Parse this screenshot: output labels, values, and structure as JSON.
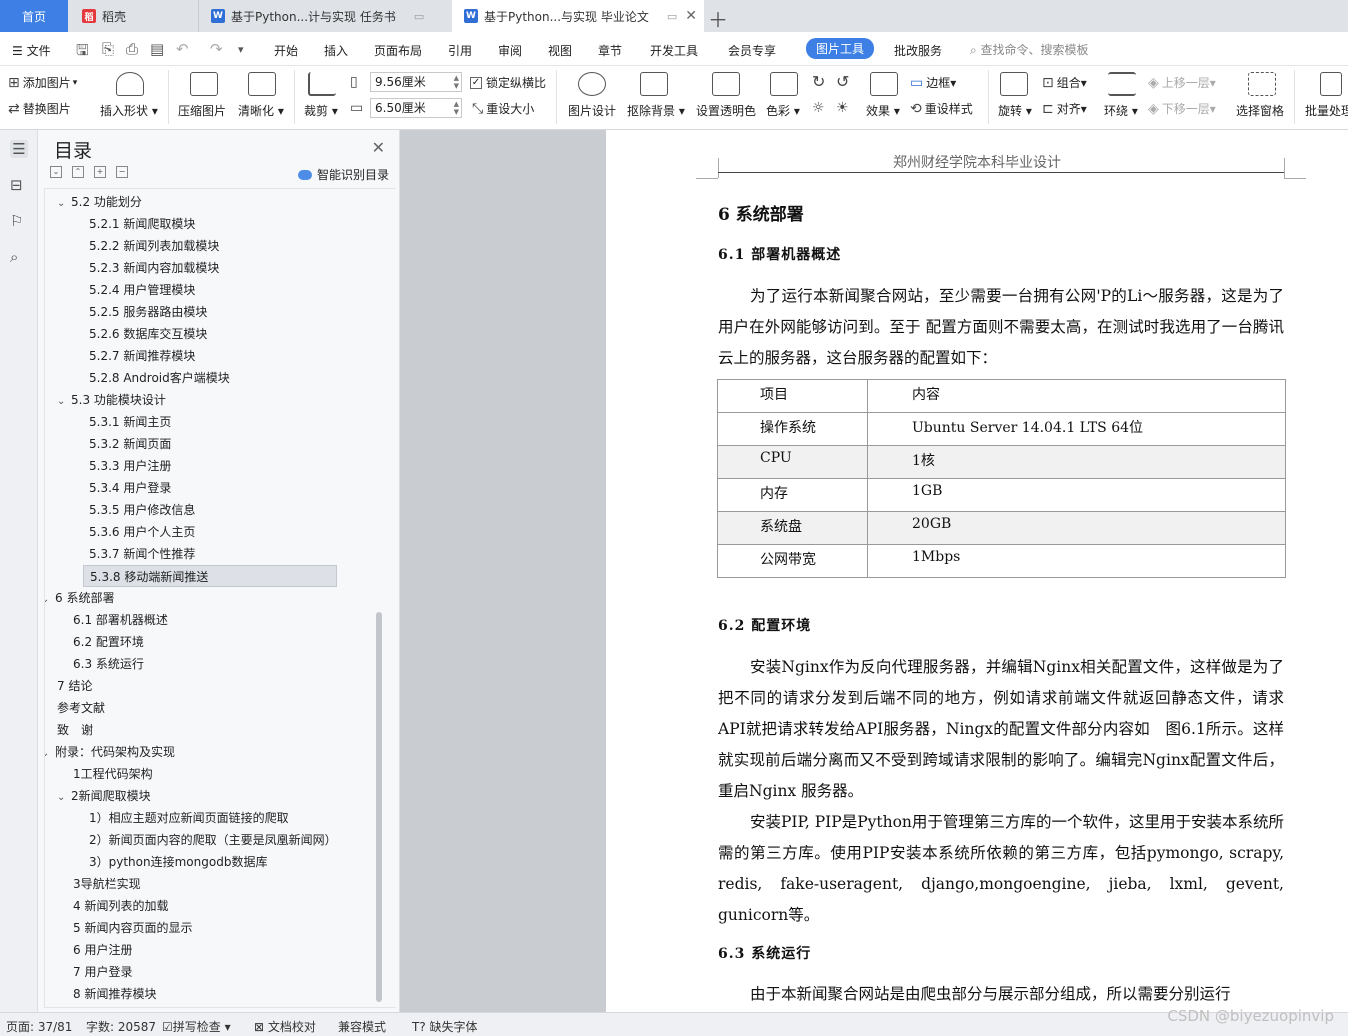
{
  "tabs": {
    "home": "首页",
    "t1": "稻壳",
    "t2": "基于Python...计与实现 任务书",
    "t3": "基于Python...与实现 毕业论文"
  },
  "menu": {
    "file": "文件",
    "items": [
      "开始",
      "插入",
      "页面布局",
      "引用",
      "审阅",
      "视图",
      "章节",
      "开发工具",
      "会员专享",
      "图片工具",
      "批改服务"
    ],
    "search": "查找命令、搜索模板"
  },
  "ribbon": {
    "add_image": "添加图片",
    "replace_image": "替换图片",
    "insert_shape": "插入形状",
    "compress": "压缩图片",
    "sharpen": "清晰化",
    "crop": "裁剪",
    "width": "9.56厘米",
    "height": "6.50厘米",
    "lock_ratio": "锁定纵横比",
    "reset_size": "重设大小",
    "image_design": "图片设计",
    "remove_bg": "抠除背景",
    "set_transparent": "设置透明色",
    "color": "色彩",
    "effect": "效果",
    "border": "边框",
    "reset_style": "重设样式",
    "rotate": "旋转",
    "group": "组合",
    "align": "对齐",
    "wrap": "环绕",
    "bring_forward": "上移一层",
    "send_backward": "下移一层",
    "selection_pane": "选择窗格",
    "batch": "批量处理"
  },
  "toc": {
    "title": "目录",
    "smart": "智能识别目录",
    "items": [
      {
        "text": "5.2 功能划分",
        "indent": 1,
        "caret": "down"
      },
      {
        "text": "5.2.1 新闻爬取模块",
        "indent": 2
      },
      {
        "text": "5.2.2 新闻列表加载模块",
        "indent": 2
      },
      {
        "text": "5.2.3 新闻内容加载模块",
        "indent": 2
      },
      {
        "text": "5.2.4 用户管理模块",
        "indent": 2
      },
      {
        "text": "5.2.5 服务器路由模块",
        "indent": 2
      },
      {
        "text": "5.2.6 数据库交互模块",
        "indent": 2
      },
      {
        "text": "5.2.7 新闻推荐模块",
        "indent": 2
      },
      {
        "text": "5.2.8 Android客户端模块",
        "indent": 2
      },
      {
        "text": "5.3 功能模块设计",
        "indent": 1,
        "caret": "down"
      },
      {
        "text": "5.3.1 新闻主页",
        "indent": 2
      },
      {
        "text": "5.3.2 新闻页面",
        "indent": 2
      },
      {
        "text": "5.3.3 用户注册",
        "indent": 2
      },
      {
        "text": "5.3.4 用户登录",
        "indent": 2
      },
      {
        "text": "5.3.5 用户修改信息",
        "indent": 2
      },
      {
        "text": "5.3.6 用户个人主页",
        "indent": 2
      },
      {
        "text": "5.3.7 新闻个性推荐",
        "indent": 2
      },
      {
        "text": "5.3.8 移动端新闻推送",
        "indent": 2,
        "selected": true
      },
      {
        "text": "6 系统部署",
        "indent": 0,
        "caret": "down"
      },
      {
        "text": "6.1 部署机器概述",
        "indent": 1
      },
      {
        "text": "6.2 配置环境",
        "indent": 1
      },
      {
        "text": "6.3 系统运行",
        "indent": 1
      },
      {
        "text": "7 结论",
        "indent": 0
      },
      {
        "text": "参考文献",
        "indent": 0
      },
      {
        "text": "致　谢",
        "indent": 0
      },
      {
        "text": "附录：代码架构及实现",
        "indent": 0,
        "caret": "down"
      },
      {
        "text": "1工程代码架构",
        "indent": 1
      },
      {
        "text": "2新闻爬取模块",
        "indent": 1,
        "caret": "down"
      },
      {
        "text": "1）相应主题对应新闻页面链接的爬取",
        "indent": 2
      },
      {
        "text": "2）新闻页面内容的爬取（主要是凤凰新闻网）",
        "indent": 2
      },
      {
        "text": "3）python连接mongodb数据库",
        "indent": 2
      },
      {
        "text": "3导航栏实现",
        "indent": 1
      },
      {
        "text": "4 新闻列表的加载",
        "indent": 1
      },
      {
        "text": "5 新闻内容页面的显示",
        "indent": 1
      },
      {
        "text": "6 用户注册",
        "indent": 1
      },
      {
        "text": "7 用户登录",
        "indent": 1
      },
      {
        "text": "8 新闻推荐模块",
        "indent": 1
      }
    ]
  },
  "doc": {
    "header": "郑州财经学院本科毕业设计",
    "h1": "6 系统部署",
    "h61": "6.1 部署机器概述",
    "p1": "为了运行本新闻聚合网站，至少需要一台拥有公网'P的Li～服务器，这是为了用户在外网能够访问到。至于 配置方面则不需要太高，在测试时我选用了一台腾讯云上的服务器，这台服务器的配置如下：",
    "table": [
      [
        "项目",
        "内容"
      ],
      [
        "操作系统",
        "Ubuntu Server 14.04.1 LTS  64位"
      ],
      [
        "CPU",
        "1核"
      ],
      [
        "内存",
        "1GB"
      ],
      [
        "系统盘",
        "20GB"
      ],
      [
        "公网带宽",
        "1Mbps"
      ]
    ],
    "h62": "6.2 配置环境",
    "p2": "安装Nginx作为反向代理服务器，并编辑Nginx相关配置文件，这样做是为了把不同的请求分发到后端不同的地方，例如请求前端文件就返回静态文件，请求API就把请求转发给API服务器，Ningx的配置文件部分内容如　图6.1所示。这样就实现前后端分离而又不受到跨域请求限制的影响了。编辑完Nginx配置文件后，重启Nginx 服务器。",
    "p3": "安装PIP, PIP是Python用于管理第三方库的一个软件，这里用于安装本系统所需的第三方库。使用PIP安装本系统所依赖的第三方库，包括pymongo, scrapy, redis, fake-useragent, django,mongoengine, jieba, lxml, gevent, gunicorn等。",
    "h63": "6.3 系统运行",
    "p4": "由于本新闻聚合网站是由爬虫部分与展示部分组成，所以需要分别运行"
  },
  "status": {
    "page": "页面: 37/81",
    "words": "字数: 20587",
    "spell": "拼写检查",
    "proof": "文档校对",
    "compat": "兼容模式",
    "missing_font": "缺失字体"
  },
  "watermark": "CSDN @biyezuopinvip"
}
